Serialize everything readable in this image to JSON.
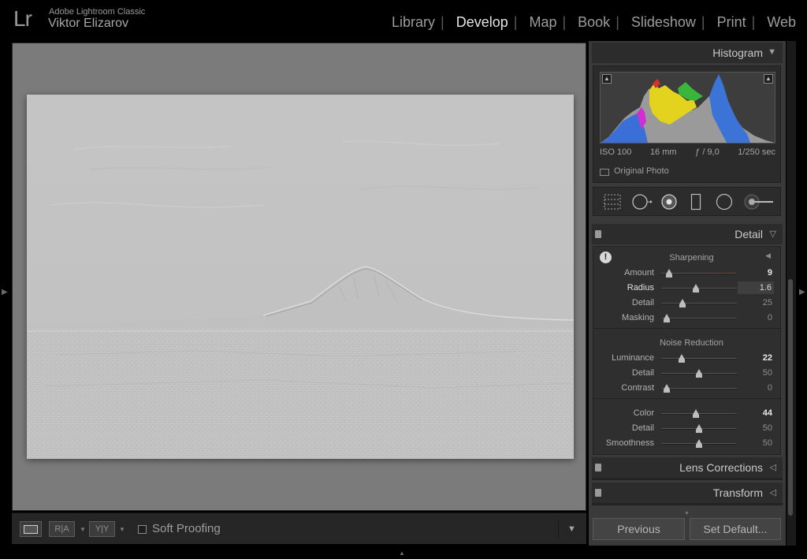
{
  "app": {
    "logo": "Lr",
    "product": "Adobe Lightroom Classic",
    "user": "Viktor Elizarov"
  },
  "modules": [
    {
      "label": "Library",
      "active": false
    },
    {
      "label": "Develop",
      "active": true
    },
    {
      "label": "Map",
      "active": false
    },
    {
      "label": "Book",
      "active": false
    },
    {
      "label": "Slideshow",
      "active": false
    },
    {
      "label": "Print",
      "active": false
    },
    {
      "label": "Web",
      "active": false
    }
  ],
  "toolbar": {
    "view_icon": "loupe-view-icon",
    "before_after_label": "R|A",
    "before_after_yy_label": "Y|Y",
    "soft_proofing": "Soft Proofing"
  },
  "histogram": {
    "title": "Histogram",
    "exif": {
      "iso": "ISO 100",
      "focal": "16 mm",
      "aperture": "ƒ / 9,0",
      "shutter": "1/250 sec"
    },
    "original_photo": "Original Photo"
  },
  "tools": [
    "crop-overlay-icon",
    "spot-removal-icon",
    "red-eye-icon",
    "graduated-filter-icon",
    "radial-filter-icon",
    "adjustment-brush-icon"
  ],
  "detail": {
    "title": "Detail",
    "sharpening": {
      "title": "Sharpening",
      "sliders": [
        {
          "label": "Amount",
          "value": "9",
          "pos": 0.1
        },
        {
          "label": "Radius",
          "value": "1.6",
          "pos": 0.46
        },
        {
          "label": "Detail",
          "value": "25",
          "pos": 0.28
        },
        {
          "label": "Masking",
          "value": "0",
          "pos": 0.07
        }
      ]
    },
    "noise_reduction": {
      "title": "Noise Reduction",
      "luminance_sliders": [
        {
          "label": "Luminance",
          "value": "22",
          "pos": 0.27
        },
        {
          "label": "Detail",
          "value": "50",
          "pos": 0.5
        },
        {
          "label": "Contrast",
          "value": "0",
          "pos": 0.07
        }
      ],
      "color_sliders": [
        {
          "label": "Color",
          "value": "44",
          "pos": 0.46
        },
        {
          "label": "Detail",
          "value": "50",
          "pos": 0.5
        },
        {
          "label": "Smoothness",
          "value": "50",
          "pos": 0.5
        }
      ]
    }
  },
  "lens_corrections": {
    "title": "Lens Corrections"
  },
  "transform": {
    "title": "Transform"
  },
  "buttons": {
    "previous": "Previous",
    "set_default": "Set Default..."
  }
}
